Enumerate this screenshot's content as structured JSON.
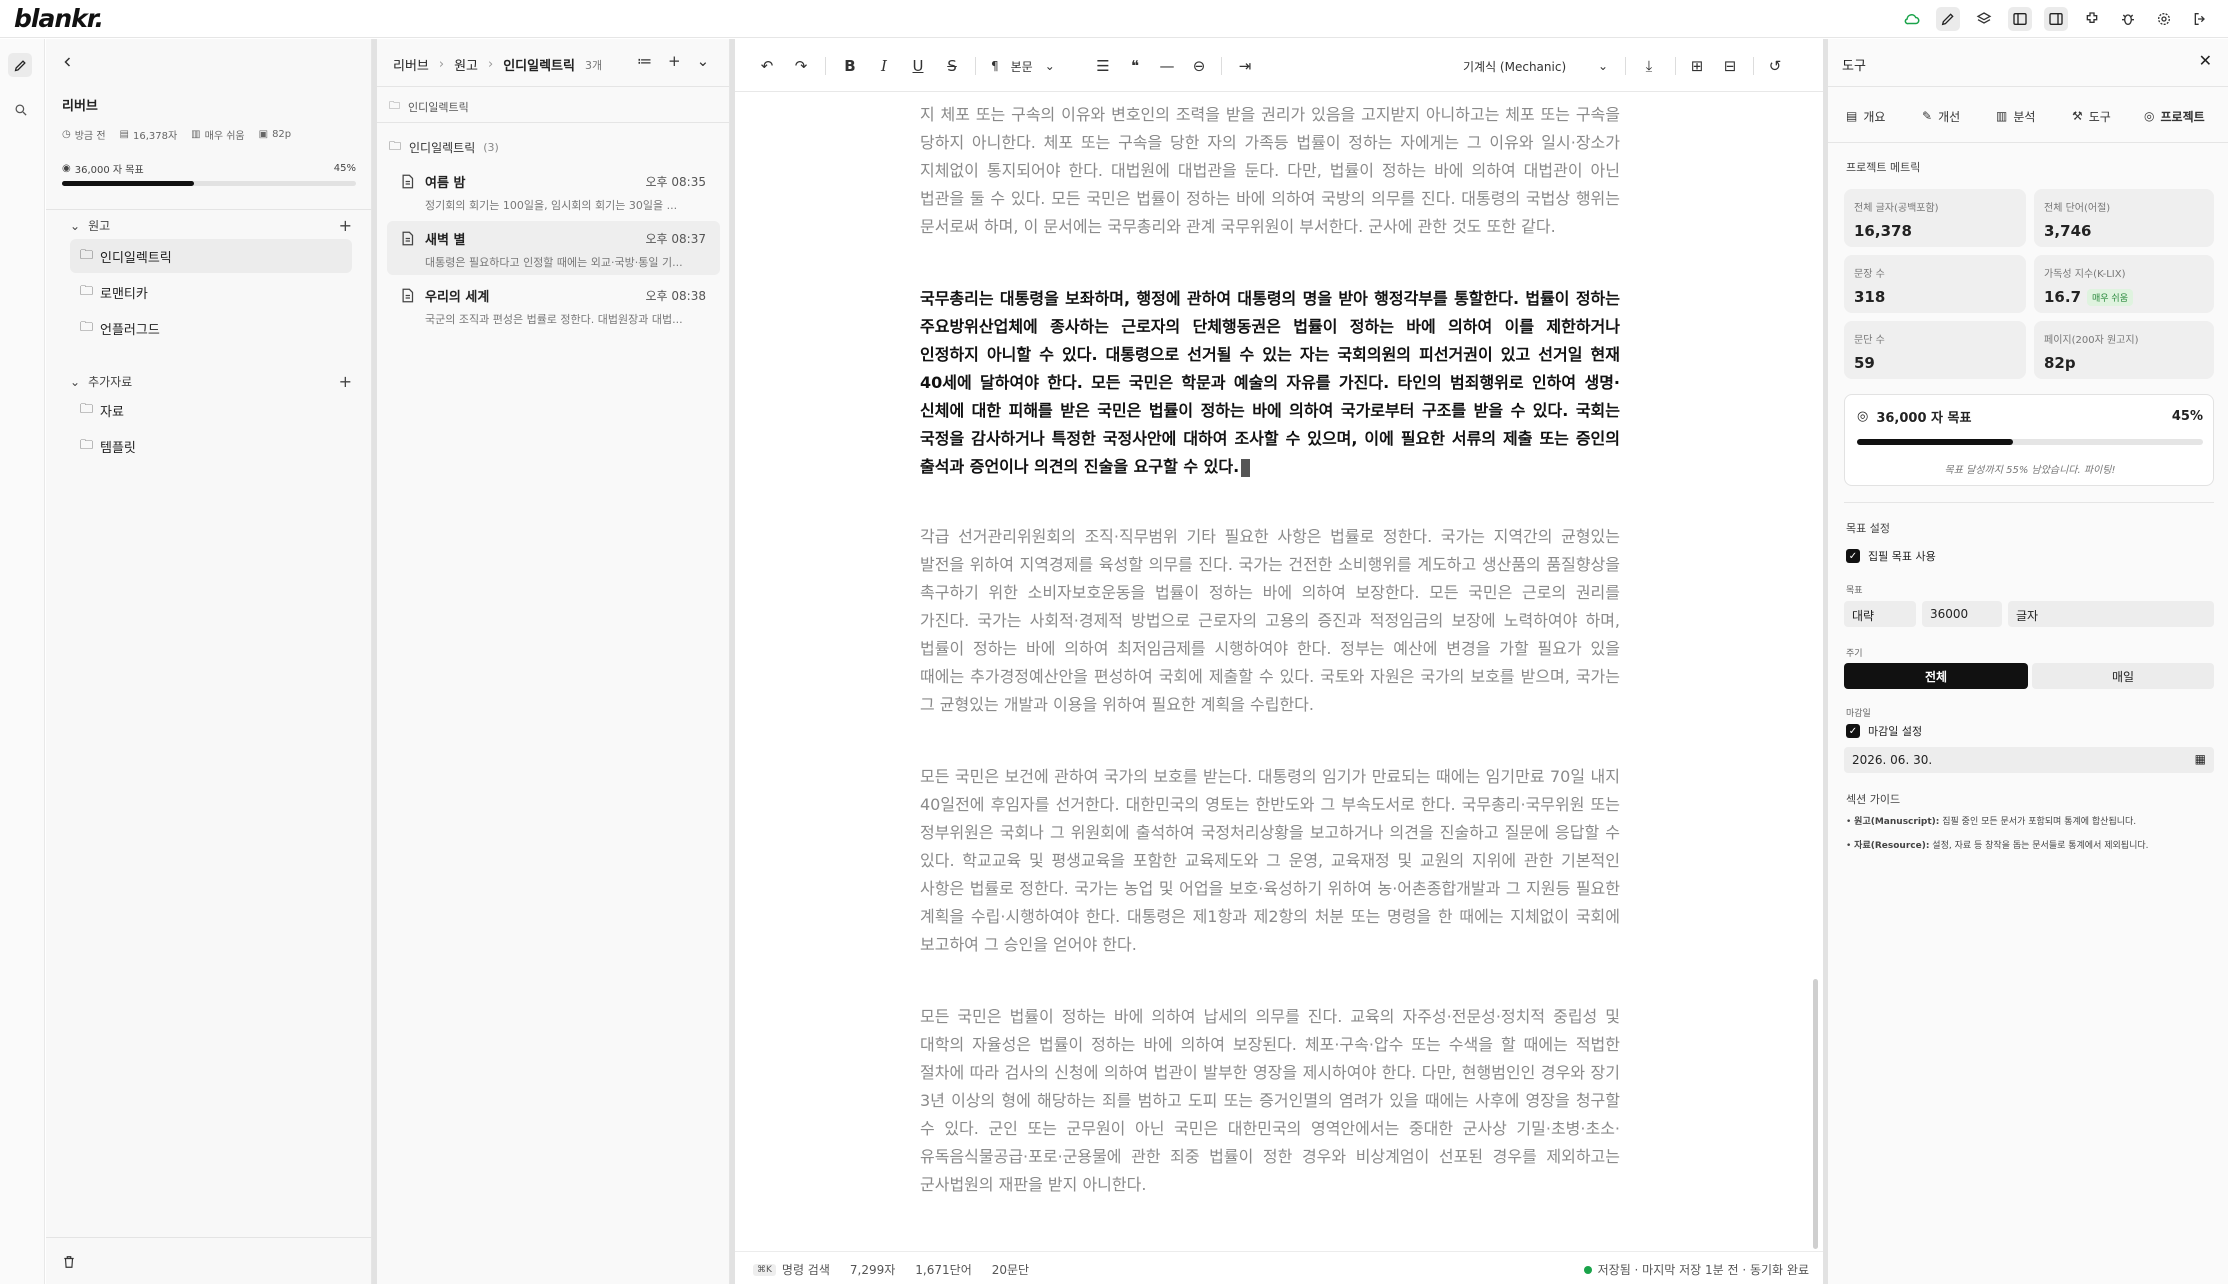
{
  "app": {
    "logo": "blankr."
  },
  "sidebar": {
    "back_icon": "chevron-left-icon",
    "project_title": "리버브",
    "meta": {
      "updated": "방금 전",
      "chars": "16,378자",
      "difficulty": "매우 쉬움",
      "pages": "82p"
    },
    "goal": {
      "label": "36,000 자 목표",
      "percent_text": "45%",
      "progress": 0.45
    },
    "sections": [
      {
        "label": "원고",
        "items": [
          "인디일렉트릭",
          "로맨티카",
          "언플러그드"
        ]
      },
      {
        "label": "추가자료",
        "items": [
          "자료",
          "템플릿"
        ]
      }
    ]
  },
  "doclist": {
    "breadcrumb": [
      "리버브",
      "원고",
      "인디일렉트릭"
    ],
    "count": "3개",
    "path_label": "인디일렉트릭",
    "folder": {
      "name": "인디일렉트릭",
      "count": "(3)"
    },
    "docs": [
      {
        "title": "여름 밤",
        "time": "오후 08:35",
        "preview": "정기회의 회기는 100일을, 임시회의 회기는 30일을 ..."
      },
      {
        "title": "새벽 별",
        "time": "오후 08:37",
        "preview": "대통령은 필요하다고 인정할 때에는 외교·국방·통일 기..."
      },
      {
        "title": "우리의 세계",
        "time": "오후 08:38",
        "preview": "국군의 조직과 편성은 법률로 정한다. 대법원장과 대법..."
      }
    ]
  },
  "editor": {
    "toolbar": {
      "style_select": "본문",
      "font_select": "기계식 (Mechanic)"
    },
    "paragraphs": [
      {
        "id": "p0",
        "text": "지 체포 또는 구속의 이유와 변호인의 조력을 받을 권리가 있음을 고지받지 아니하고는 체포 또는 구속을 당하지 아니한다. 체포 또는 구속을 당한 자의 가족등 법률이 정하는 자에게는 그 이유와 일시·장소가 지체없이 통지되어야 한다. 대법원에 대법관을 둔다. 다만, 법률이 정하는 바에 의하여 대법관이 아닌 법관을 둘 수 있다. 모든 국민은 법률이 정하는 바에 의하여 국방의 의무를 진다. 대통령의 국법상 행위는 문서로써 하며, 이 문서에는 국무총리와 관계 국무위원이 부서한다. 군사에 관한 것도 또한 같다."
      },
      {
        "id": "p1",
        "text": "국무총리는 대통령을 보좌하며, 행정에 관하여 대통령의 명을 받아 행정각부를 통할한다. 법률이 정하는 주요방위산업체에 종사하는 근로자의 단체행동권은 법률이 정하는 바에 의하여 이를 제한하거나 인정하지 아니할 수 있다. 대통령으로 선거될 수 있는 자는 국회의원의 피선거권이 있고 선거일 현재 40세에 달하여야 한다. 모든 국민은 학문과 예술의 자유를 가진다. 타인의 범죄행위로 인하여 생명·신체에 대한 피해를 받은 국민은 법률이 정하는 바에 의하여 국가로부터 구조를 받을 수 있다. 국회는 국정을 감사하거나 특정한 국정사안에 대하여 조사할 수 있으며, 이에 필요한 서류의 제출 또는 증인의 출석과 증언이나 의견의 진술을 요구할 수 있다."
      },
      {
        "id": "p2",
        "text": "각급 선거관리위원회의 조직·직무범위 기타 필요한 사항은 법률로 정한다. 국가는 지역간의 균형있는 발전을 위하여 지역경제를 육성할 의무를 진다. 국가는 건전한 소비행위를 계도하고 생산품의 품질향상을 촉구하기 위한 소비자보호운동을 법률이 정하는 바에 의하여 보장한다. 모든 국민은 근로의 권리를 가진다. 국가는 사회적·경제적 방법으로 근로자의 고용의 증진과 적정임금의 보장에 노력하여야 하며, 법률이 정하는 바에 의하여 최저임금제를 시행하여야 한다. 정부는 예산에 변경을 가할 필요가 있을 때에는 추가경정예산안을 편성하여 국회에 제출할 수 있다. 국토와 자원은 국가의 보호를 받으며, 국가는 그 균형있는 개발과 이용을 위하여 필요한 계획을 수립한다."
      },
      {
        "id": "p3",
        "text": "모든 국민은 보건에 관하여 국가의 보호를 받는다. 대통령의 임기가 만료되는 때에는 임기만료 70일 내지 40일전에 후임자를 선거한다. 대한민국의 영토는 한반도와 그 부속도서로 한다. 국무총리·국무위원 또는 정부위원은 국회나 그 위원회에 출석하여 국정처리상황을 보고하거나 의견을 진술하고 질문에 응답할 수 있다. 학교교육 및 평생교육을 포함한 교육제도와 그 운영, 교육재정 및 교원의 지위에 관한 기본적인 사항은 법률로 정한다. 국가는 농업 및 어업을 보호·육성하기 위하여 농·어촌종합개발과 그 지원등 필요한 계획을 수립·시행하여야 한다. 대통령은 제1항과 제2항의 처분 또는 명령을 한 때에는 지체없이 국회에 보고하여 그 승인을 얻어야 한다."
      },
      {
        "id": "p4",
        "text": "모든 국민은 법률이 정하는 바에 의하여 납세의 의무를 진다. 교육의 자주성·전문성·정치적 중립성 및 대학의 자율성은 법률이 정하는 바에 의하여 보장된다. 체포·구속·압수 또는 수색을 할 때에는 적법한 절차에 따라 검사의 신청에 의하여 법관이 발부한 영장을 제시하여야 한다. 다만, 현행범인인 경우와 장기 3년 이상의 형에 해당하는 죄를 범하고 도피 또는 증거인멸의 염려가 있을 때에는 사후에 영장을 청구할 수 있다. 군인 또는 군무원이 아닌 국민은 대한민국의 영역안에서는 중대한 군사상 기밀·초병·초소·유독음식물공급·포로·군용물에 관한 죄중 법률이 정한 경우와 비상계엄이 선포된 경우를 제외하고는 군사법원의 재판을 받지 아니한다."
      }
    ],
    "status": {
      "kbd": "⌘K",
      "command": "명령 검색",
      "chars": "7,299자",
      "words": "1,671단어",
      "paragraphs": "20문단",
      "save": "저장됨 · 마지막 저장 1분 전 · 동기화 완료",
      "save_color": "#1aa34a"
    }
  },
  "tools": {
    "title": "도구",
    "tabs": [
      "개요",
      "개선",
      "분석",
      "도구",
      "프로젝트"
    ],
    "metrics_title": "프로젝트 메트릭",
    "cards": [
      {
        "label": "전체 글자(공백포함)",
        "value": "16,378"
      },
      {
        "label": "전체 단어(어절)",
        "value": "3,746"
      },
      {
        "label": "문장 수",
        "value": "318"
      },
      {
        "label": "가독성 지수(K-LIX)",
        "value": "16.7",
        "badge": "매우 쉬움"
      },
      {
        "label": "문단 수",
        "value": "59"
      },
      {
        "label": "페이지(200자 원고지)",
        "value": "82p"
      }
    ],
    "goal": {
      "label": "36,000 자 목표",
      "percent_text": "45%",
      "progress": 0.45,
      "note": "목표 달성까지 55% 남았습니다. 파이팅!"
    },
    "goal_settings": {
      "title": "목표 설정",
      "use_goal": "집필 목표 사용",
      "target_label": "목표",
      "target": {
        "scope": "대략",
        "value": "36000",
        "unit": "글자"
      },
      "period_label": "주기",
      "period_options": [
        "전체",
        "매일"
      ],
      "deadline_label": "마감일",
      "deadline_check": "마감일 설정",
      "deadline_value": "2026. 06. 30."
    },
    "guide": {
      "title": "섹션 가이드",
      "items": [
        {
          "term": "원고(Manuscript):",
          "desc": "집필 중인 모든 문서가 포함되며 통계에 합산됩니다."
        },
        {
          "term": "자료(Resource):",
          "desc": "설정, 자료 등 창작을 돕는 문서들로 통계에서 제외됩니다."
        }
      ]
    }
  }
}
